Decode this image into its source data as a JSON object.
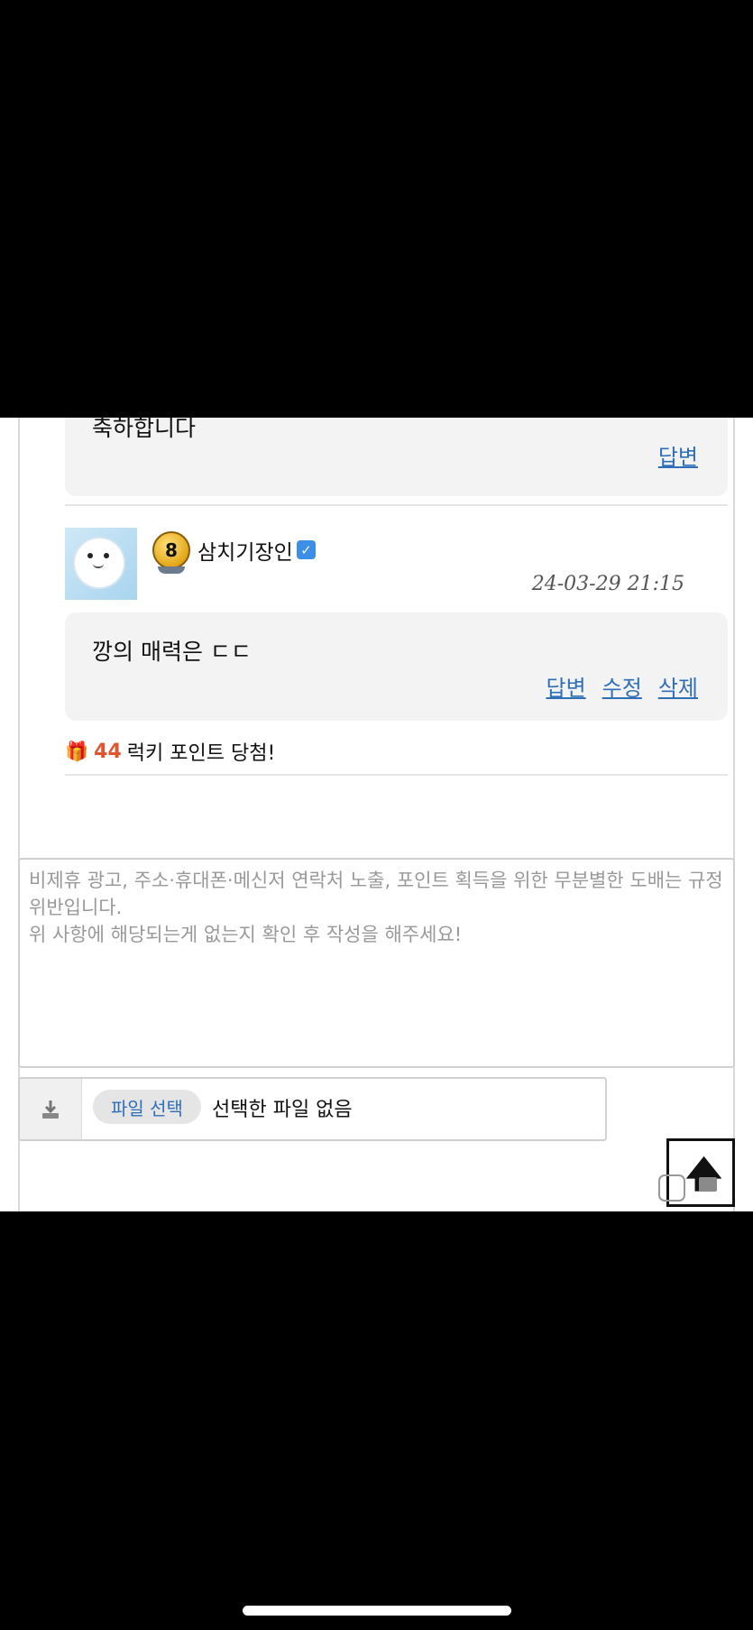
{
  "comments": [
    {
      "text": "축하합니다",
      "actions": [
        "답변"
      ]
    },
    {
      "username": "삼치기장인",
      "level": "8",
      "timestamp": "24-03-29 21:15",
      "text": "깡의 매력은 ㄷㄷ",
      "actions": [
        "답변",
        "수정",
        "삭제"
      ]
    }
  ],
  "lucky": {
    "points": "44",
    "label": "럭키 포인트 당첨!"
  },
  "compose": {
    "placeholder": "비제휴 광고, 주소·휴대폰·메신저 연락처 노출, 포인트 획득을 위한 무분별한 도배는 규정 위반입니다.\n위 사항에 해당되는게 없는지 확인 후 작성을 해주세요!"
  },
  "file": {
    "button_label": "파일 선택",
    "status": "선택한 파일 없음"
  },
  "colors": {
    "link": "#2f6fb8",
    "lucky_number": "#e0552f",
    "verified": "#3d8ee6"
  }
}
